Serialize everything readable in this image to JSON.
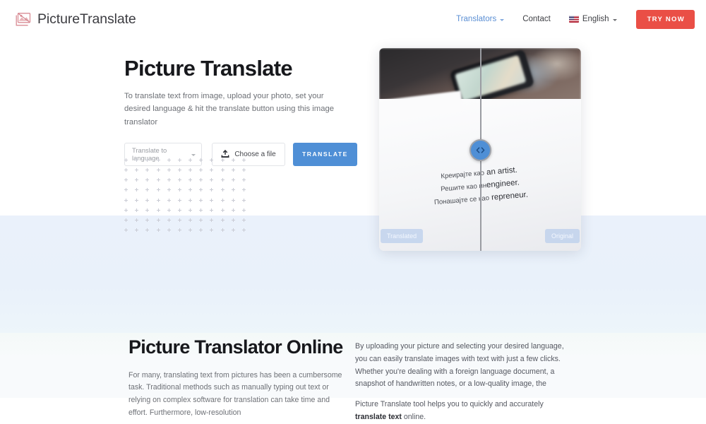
{
  "header": {
    "logo": {
      "icon": "picture-icon",
      "text_primary": "Picture",
      "text_secondary": "Translate",
      "icon_color": "#d98c95"
    },
    "nav": [
      {
        "label": "Translators",
        "has_chevron": true,
        "color": "#5b8fd4"
      },
      {
        "label": "Contact",
        "has_chevron": false,
        "color": "#3f4045"
      }
    ],
    "language": {
      "label": "English",
      "flag": "us-flag-icon",
      "has_chevron": true
    },
    "cta": {
      "label": "TRY NOW",
      "color": "#ea4f46"
    }
  },
  "hero": {
    "title": "Picture Translate",
    "subtitle": "To translate text from image, upload your photo, set your desired language & hit the translate button using this image translator",
    "form": {
      "language_select": {
        "value": "Translate to language",
        "placeholder": "Translate to language",
        "chevron": "chevron-down-icon"
      },
      "file_button": {
        "label": "Choose a file",
        "icon": "upload-icon"
      },
      "submit_button": {
        "label": "TRANSLATE",
        "color": "#4f8fd6"
      }
    },
    "decoration": {
      "pattern": "plus-dot-grid",
      "columns": 12,
      "rows": 8,
      "color": "#c9cbd4"
    }
  },
  "comparison": {
    "slider_handle": {
      "icon": "left-right-arrows-icon",
      "color": "#4f8fd6",
      "position_percent": 50
    },
    "badge_left": "Translated",
    "badge_right": "Original",
    "quote_lines": [
      {
        "translated": "Креирајте као",
        "original": "an artist."
      },
      {
        "translated": "Решите као ин",
        "original": "engineer."
      },
      {
        "translated": "Понашајте се као",
        "original": "repreneur."
      }
    ]
  },
  "lower": {
    "title": "Picture Translator Online",
    "left_body": "For many, translating text from pictures has been a cumbersome task. Traditional methods such as manually typing out text or relying on complex software for translation can take time and effort. Furthermore, low-resolution",
    "right_body_1": "By uploading your picture and selecting your desired language, you can easily translate images with text with just a few clicks. Whether you're dealing with a foreign language document, a snapshot of handwritten notes, or a low-quality image, the",
    "right_body_2_pre": "Picture Translate tool helps you to quickly and accurately ",
    "right_body_2_bold": "translate text",
    "right_body_2_post": " online."
  }
}
